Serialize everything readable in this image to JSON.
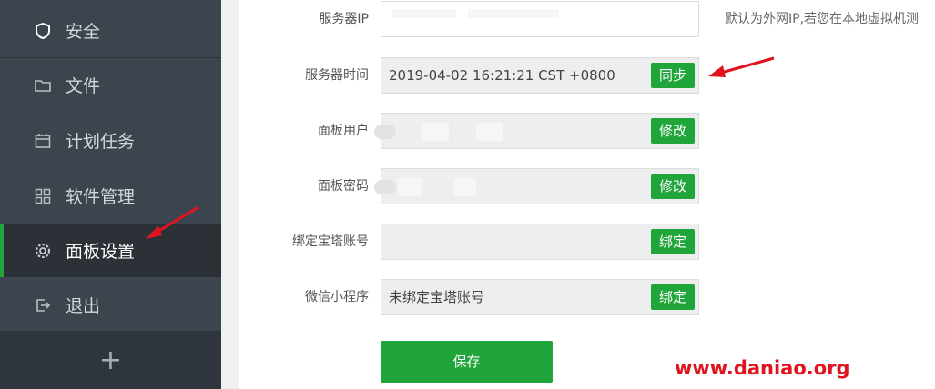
{
  "sidebar": {
    "items": [
      {
        "label": "安全",
        "icon": "shield-icon"
      },
      {
        "label": "文件",
        "icon": "folder-icon"
      },
      {
        "label": "计划任务",
        "icon": "calendar-icon"
      },
      {
        "label": "软件管理",
        "icon": "grid-icon"
      },
      {
        "label": "面板设置",
        "icon": "gear-icon"
      },
      {
        "label": "退出",
        "icon": "logout-icon"
      }
    ],
    "add_label": "+"
  },
  "form": {
    "server_ip": {
      "label": "服务器IP",
      "value": ""
    },
    "server_time": {
      "label": "服务器时间",
      "value": "2019-04-02 16:21:21 CST +0800",
      "button": "同步"
    },
    "panel_user": {
      "label": "面板用户",
      "value": "",
      "button": "修改"
    },
    "panel_password": {
      "label": "面板密码",
      "value": "",
      "button": "修改"
    },
    "bind_account": {
      "label": "绑定宝塔账号",
      "value": "",
      "button": "绑定"
    },
    "wechat_app": {
      "label": "微信小程序",
      "value": "未绑定宝塔账号",
      "button": "绑定"
    },
    "save_label": "保存",
    "ip_note": "默认为外网IP,若您在本地虚拟机测"
  },
  "watermark": "www.daniao.org",
  "colors": {
    "accent": "#20a53a",
    "sidebar": "#3c444d",
    "arrow": "#e0141e"
  }
}
